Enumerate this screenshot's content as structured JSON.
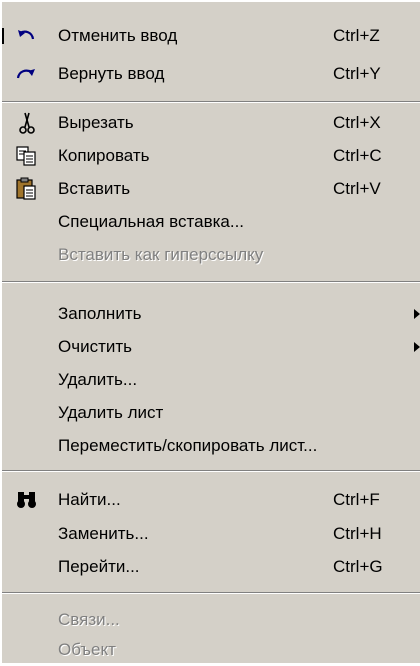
{
  "menu": {
    "items": [
      {
        "label": "Отменить ввод",
        "shortcut": "Ctrl+Z",
        "icon": "undo-icon",
        "enabled": true
      },
      {
        "label": "Вернуть ввод",
        "shortcut": "Ctrl+Y",
        "icon": "redo-icon",
        "enabled": true
      },
      {
        "label": "Вырезать",
        "shortcut": "Ctrl+X",
        "icon": "scissors-icon",
        "enabled": true
      },
      {
        "label": "Копировать",
        "shortcut": "Ctrl+C",
        "icon": "copy-icon",
        "enabled": true
      },
      {
        "label": "Вставить",
        "shortcut": "Ctrl+V",
        "icon": "paste-icon",
        "enabled": true
      },
      {
        "label": "Специальная вставка...",
        "enabled": true
      },
      {
        "label": "Вставить как гиперссылку",
        "enabled": false
      },
      {
        "label": "Заполнить",
        "submenu": true,
        "enabled": true
      },
      {
        "label": "Очистить",
        "submenu": true,
        "enabled": true
      },
      {
        "label": "Удалить...",
        "enabled": true
      },
      {
        "label": "Удалить лист",
        "enabled": true
      },
      {
        "label": "Переместить/скопировать лист...",
        "enabled": true
      },
      {
        "label": "Найти...",
        "shortcut": "Ctrl+F",
        "icon": "binoculars-icon",
        "enabled": true
      },
      {
        "label": "Заменить...",
        "shortcut": "Ctrl+H",
        "enabled": true
      },
      {
        "label": "Перейти...",
        "shortcut": "Ctrl+G",
        "enabled": true
      },
      {
        "label": "Связи...",
        "enabled": false
      },
      {
        "label": "Объект",
        "enabled": false
      }
    ]
  },
  "colors": {
    "menu_background": "#d4d0c8",
    "text": "#000000",
    "disabled_text": "#808080",
    "highlight_white": "#ffffff",
    "separator_shadow": "#808080"
  }
}
